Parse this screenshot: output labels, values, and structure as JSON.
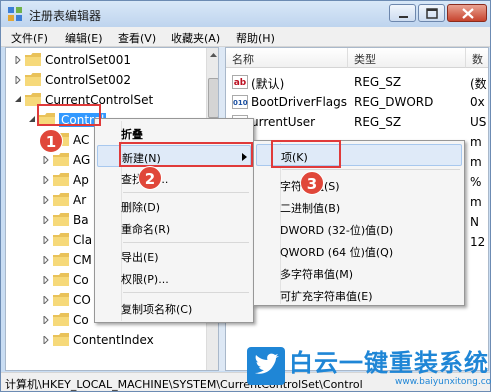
{
  "window": {
    "title": "注册表编辑器"
  },
  "menubar": [
    "文件(F)",
    "编辑(E)",
    "查看(V)",
    "收藏夹(A)",
    "帮助(H)"
  ],
  "tree": [
    {
      "label": "ControlSet001",
      "expander": "collapsed"
    },
    {
      "label": "ControlSet002",
      "expander": "collapsed"
    },
    {
      "label": "CurrentControlSet",
      "expander": "expanded"
    },
    {
      "label": "Control",
      "expander": "expanded",
      "selected": true
    },
    {
      "label": "AC",
      "expander": "none"
    },
    {
      "label": "AG",
      "expander": "collapsed"
    },
    {
      "label": "Ap",
      "expander": "collapsed"
    },
    {
      "label": "Ar",
      "expander": "collapsed"
    },
    {
      "label": "Ba",
      "expander": "collapsed"
    },
    {
      "label": "Cla",
      "expander": "collapsed"
    },
    {
      "label": "CM",
      "expander": "collapsed"
    },
    {
      "label": "Co",
      "expander": "collapsed"
    },
    {
      "label": "CO",
      "expander": "collapsed"
    },
    {
      "label": "Co",
      "expander": "collapsed"
    },
    {
      "label": "ContentIndex",
      "expander": "collapsed"
    }
  ],
  "columns": {
    "name": "名称",
    "type": "类型",
    "data": "数"
  },
  "values": [
    {
      "icon": "ab",
      "name": "(默认)",
      "type": "REG_SZ",
      "data": "(数"
    },
    {
      "icon": "bin",
      "name": "BootDriverFlags",
      "type": "REG_DWORD",
      "data": "0x"
    },
    {
      "icon": "ab",
      "name": "urrentUser",
      "type": "REG_SZ",
      "data": "US"
    },
    {
      "icon": "",
      "name": "",
      "type": "",
      "data": "m"
    },
    {
      "icon": "",
      "name": "",
      "type": "",
      "data": "m"
    },
    {
      "icon": "",
      "name": "",
      "type": "",
      "data": "%"
    },
    {
      "icon": "",
      "name": "",
      "type": "",
      "data": "m"
    },
    {
      "icon": "",
      "name": "",
      "type": "",
      "data": "N"
    },
    {
      "icon": "",
      "name": "",
      "type": "",
      "data": "12"
    }
  ],
  "context_menu": {
    "items": [
      "折叠",
      "新建(N)",
      "查找(F)...",
      "删除(D)",
      "重命名(R)",
      "导出(E)",
      "权限(P)...",
      "复制项名称(C)"
    ]
  },
  "submenu": {
    "items": [
      "项(K)",
      "字符串值(S)",
      "二进制值(B)",
      "DWORD (32-位)值(D)",
      "QWORD (64 位)值(Q)",
      "多字符串值(M)",
      "可扩充字符串值(E)"
    ]
  },
  "badges": [
    "1",
    "2",
    "3"
  ],
  "statusbar": {
    "path": "计算机\\HKEY_LOCAL_MACHINE\\SYSTEM\\CurrentControlSet\\Control"
  },
  "watermark": {
    "text": "白云一键重装系统",
    "url": "www.baiyunxitong.com"
  },
  "colors": {
    "accent": "#3399ff",
    "annotation_red": "#e03a3a",
    "watermark_blue": "#1f86d6"
  }
}
